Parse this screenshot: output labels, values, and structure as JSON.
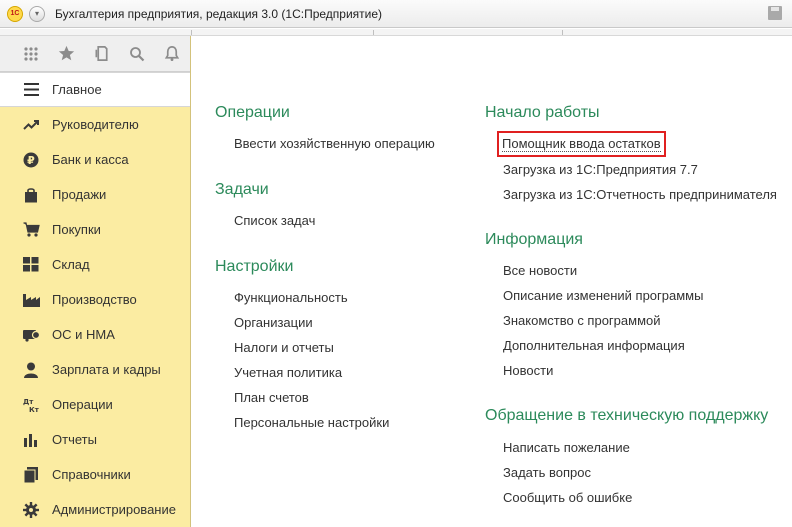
{
  "window": {
    "title": "Бухгалтерия предприятия, редакция 3.0  (1С:Предприятие)",
    "logo_text": "1С"
  },
  "sidebar": {
    "toolbar_icons": [
      "apps-grid-icon",
      "star-icon",
      "history-icon",
      "search-icon",
      "bell-icon"
    ],
    "items": [
      {
        "label": "Главное",
        "icon": "menu-icon",
        "active": true
      },
      {
        "label": "Руководителю",
        "icon": "chart-up-icon"
      },
      {
        "label": "Банк и касса",
        "icon": "ruble-icon"
      },
      {
        "label": "Продажи",
        "icon": "bag-icon"
      },
      {
        "label": "Покупки",
        "icon": "cart-icon"
      },
      {
        "label": "Склад",
        "icon": "warehouse-icon"
      },
      {
        "label": "Производство",
        "icon": "factory-icon"
      },
      {
        "label": "ОС и НМА",
        "icon": "assets-icon"
      },
      {
        "label": "Зарплата и кадры",
        "icon": "person-icon"
      },
      {
        "label": "Операции",
        "icon": "dt-kt-icon"
      },
      {
        "label": "Отчеты",
        "icon": "bar-chart-icon"
      },
      {
        "label": "Справочники",
        "icon": "book-icon"
      },
      {
        "label": "Администрирование",
        "icon": "gear-icon"
      }
    ]
  },
  "main": {
    "left": {
      "operations": {
        "title": "Операции",
        "links": [
          "Ввести хозяйственную операцию"
        ]
      },
      "tasks": {
        "title": "Задачи",
        "links": [
          "Список задач"
        ]
      },
      "settings": {
        "title": "Настройки",
        "links": [
          "Функциональность",
          "Организации",
          "Налоги и отчеты",
          "Учетная политика",
          "План счетов",
          "Персональные настройки"
        ]
      }
    },
    "right": {
      "start": {
        "title": "Начало работы",
        "links": [
          "Помощник ввода остатков",
          "Загрузка из 1С:Предприятия 7.7",
          "Загрузка из 1С:Отчетность предпринимателя"
        ]
      },
      "info": {
        "title": "Информация",
        "links": [
          "Все новости",
          "Описание изменений программы",
          "Знакомство с программой",
          "Дополнительная информация",
          "Новости"
        ]
      },
      "support": {
        "title": "Обращение в техническую поддержку",
        "links": [
          "Написать пожелание",
          "Задать вопрос",
          "Сообщить об ошибке"
        ]
      }
    }
  },
  "colors": {
    "section_title": "#2c8a5b",
    "sidebar_bg": "#fbeca2",
    "highlight_box": "#e02020"
  }
}
